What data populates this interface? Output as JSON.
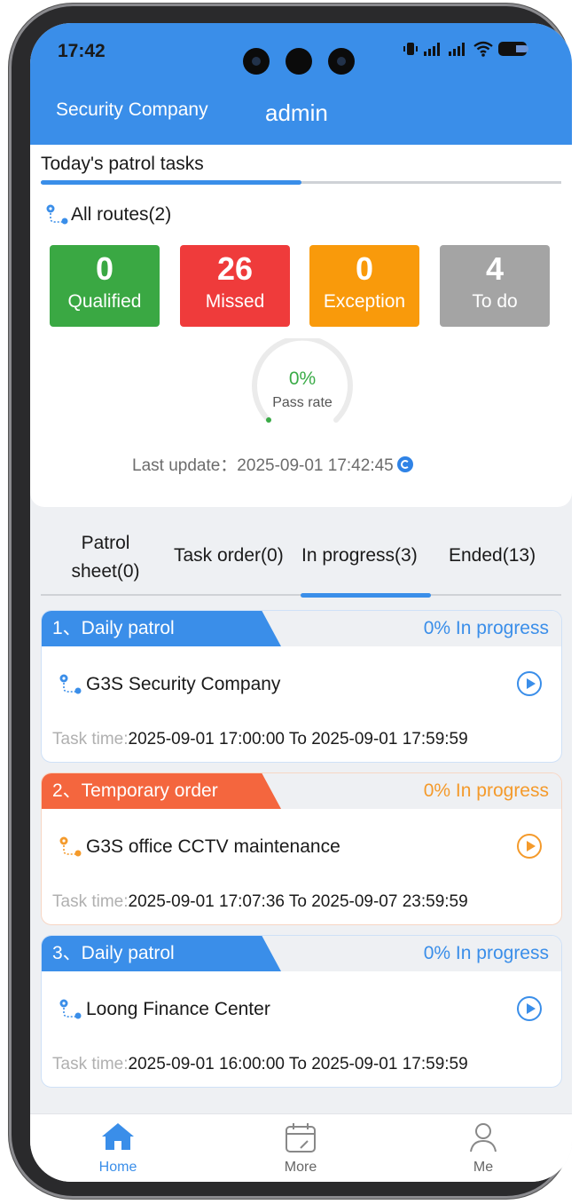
{
  "status_bar": {
    "time": "17:42"
  },
  "header": {
    "company": "Security Company",
    "user": "admin"
  },
  "summary": {
    "title": "Today's patrol tasks",
    "routes_label": "All routes(2)",
    "stats": [
      {
        "value": "0",
        "label": "Qualified",
        "color": "#3aa843"
      },
      {
        "value": "26",
        "label": "Missed",
        "color": "#ef3b3b"
      },
      {
        "value": "0",
        "label": "Exception",
        "color": "#f99a0b"
      },
      {
        "value": "4",
        "label": "To do",
        "color": "#a4a4a4"
      }
    ],
    "pass_rate_value": "0%",
    "pass_rate_label": "Pass rate",
    "pass_rate_fraction": 0,
    "last_update": "Last update：2025-09-01 17:42:45"
  },
  "tabs": {
    "patrol_sheet_line1": "Patrol",
    "patrol_sheet_line2": "sheet(0)",
    "task_order": "Task order(0)",
    "in_progress": "In progress(3)",
    "ended": "Ended(13)"
  },
  "tasks": [
    {
      "title": "1、Daily patrol",
      "status": "0% In progress",
      "site": "G3S Security Company",
      "time_label": "Task time:",
      "time_value": "2025-09-01 17:00:00 To 2025-09-01 17:59:59",
      "accent": "#3a8ee9"
    },
    {
      "title": "2、Temporary order",
      "status": "0% In progress",
      "site": "G3S office CCTV maintenance",
      "time_label": "Task time:",
      "time_value": "2025-09-01 17:07:36 To 2025-09-07 23:59:59",
      "accent": "#f4663e"
    },
    {
      "title": "3、Daily patrol",
      "status": "0% In progress",
      "site": "Loong Finance Center",
      "time_label": "Task time:",
      "time_value": "2025-09-01 16:00:00 To 2025-09-01 17:59:59",
      "accent": "#3a8ee9"
    }
  ],
  "nav": {
    "home": "Home",
    "more": "More",
    "me": "Me"
  }
}
